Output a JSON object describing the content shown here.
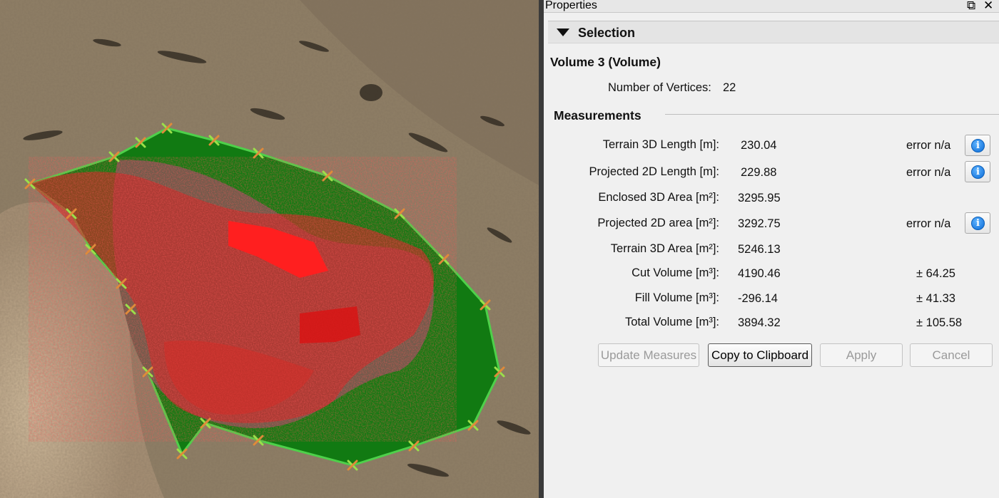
{
  "panel": {
    "title": "Properties",
    "float_icon": "⧉",
    "close_icon": "✕",
    "section_label": "Selection",
    "object_title": "Volume 3 (Volume)",
    "vertices_label": "Number of Vertices:",
    "vertices_value": "22",
    "measurements_label": "Measurements"
  },
  "measurements": [
    {
      "label": "Terrain 3D Length [m]:",
      "value": "230.04",
      "extra": "error n/a",
      "info": true
    },
    {
      "label": "Projected 2D Length [m]:",
      "value": "229.88",
      "extra": "error n/a",
      "info": true
    },
    {
      "label": "Enclosed 3D Area [m²]:",
      "value": "3295.95",
      "extra": "",
      "info": false
    },
    {
      "label": "Projected 2D area [m²]:",
      "value": "3292.75",
      "extra": "error n/a",
      "info": true
    },
    {
      "label": "Terrain 3D Area [m²]:",
      "value": "5246.13",
      "extra": "",
      "info": false
    },
    {
      "label": "Cut Volume [m³]:",
      "value": "4190.46",
      "extra": "± 64.25",
      "info": false
    },
    {
      "label": "Fill Volume [m³]:",
      "value": "-296.14",
      "extra": "± 41.33",
      "info": false
    },
    {
      "label": "Total Volume [m³]:",
      "value": "3894.32",
      "extra": "± 105.58",
      "info": false
    }
  ],
  "buttons": {
    "update": "Update Measures",
    "copy": "Copy to Clipboard",
    "apply": "Apply",
    "cancel": "Cancel"
  },
  "info_glyph": "i",
  "colors": {
    "fill_green": "#117a12",
    "cut_red": "#ff1a1a",
    "vertex_marker": "#9be04a",
    "terrain": "#8e7f68"
  },
  "icons": [
    "restore-float-icon",
    "close-icon",
    "collapse-triangle-icon",
    "info-icon",
    "vertex-marker-icon"
  ]
}
